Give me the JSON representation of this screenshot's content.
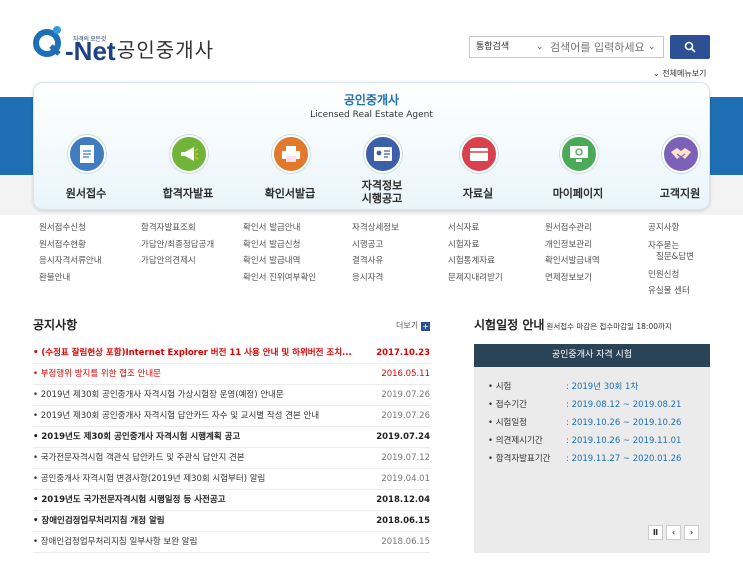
{
  "header": {
    "logo_slogan": "자격의 모든것",
    "logo_text": "Net",
    "site_title": "공인중개사",
    "search": {
      "type_value": "통합검색",
      "placeholder": "검색어를 입력하세요"
    },
    "all_menu_label": "전체메뉴보기"
  },
  "panel": {
    "title": "공인중개사",
    "subtitle": "Licensed Real Estate Agent"
  },
  "nav": [
    {
      "label": "원서접수",
      "icon": "document-icon",
      "color": "#3f7cc0"
    },
    {
      "label": "합격자발표",
      "icon": "megaphone-icon",
      "color": "#72b43a"
    },
    {
      "label": "확인서발급",
      "icon": "printer-icon",
      "color": "#e0792c"
    },
    {
      "label": "자격정보\n시행공고",
      "icon": "id-card-icon",
      "color": "#3d5fa8"
    },
    {
      "label": "자료실",
      "icon": "folder-icon",
      "color": "#d9414e"
    },
    {
      "label": "마이페이지",
      "icon": "monitor-icon",
      "color": "#4aaa5a"
    },
    {
      "label": "고객지원",
      "icon": "handshake-icon",
      "color": "#7b62b8"
    }
  ],
  "sublinks": [
    [
      "원서접수신청",
      "원서접수현황",
      "응시자격서류안내",
      "환불안내"
    ],
    [
      "합격자발표조회",
      "가답안/최종정답공개",
      "가답안의견제시"
    ],
    [
      "확인서 발급안내",
      "확인서 발급신청",
      "확인서 발급내역",
      "확인서 진위여부확인"
    ],
    [
      "자격상세정보",
      "시행공고",
      "결격사유",
      "응시자격"
    ],
    [
      "서식자료",
      "시험자료",
      "시험통계자료",
      "문제지내려받기"
    ],
    [
      "원서접수관리",
      "개인정보관리",
      "확인서발급내역",
      "면제정보보기"
    ],
    [
      "공지사항",
      "자주묻는\n질문&답변",
      "민원신청",
      "유실물 센터"
    ]
  ],
  "notices": {
    "title": "공지사항",
    "more_label": "더보기",
    "items": [
      {
        "text": "(수정표 잘림현상 포함)Internet Explorer 버전 11 사용 안내 및 하위버전 조치...",
        "date": "2017.10.23",
        "style": "red bold"
      },
      {
        "text": "부정행위 방지를 위한 협조 안내문",
        "date": "2016.05.11",
        "style": "red"
      },
      {
        "text": "2019년 제30회 공인중개사 자격시험 가상시험장 운영(예정) 안내문",
        "date": "2019.07.26",
        "style": ""
      },
      {
        "text": "2019년 제30회 공인중개사 자격시험 답안카드 자수 및 교시별 작성 견본 안내",
        "date": "2019.07.26",
        "style": ""
      },
      {
        "text": "2019년도 제30회 공인중개사 자격시험 시행계획 공고",
        "date": "2019.07.24",
        "style": "bold"
      },
      {
        "text": "국가전문자격시험 객관식 답안카드 및 주관식 답안지 견본",
        "date": "2019.07.12",
        "style": ""
      },
      {
        "text": "공인중개사 자격시험 변경사항(2019년 제30회 시험부터) 알림",
        "date": "2019.04.01",
        "style": ""
      },
      {
        "text": "2019년도 국가전문자격시험 시행일정 등 사전공고",
        "date": "2018.12.04",
        "style": "bold"
      },
      {
        "text": "장애인검정업무처리지침 개정 알림",
        "date": "2018.06.15",
        "style": "bold"
      },
      {
        "text": "장애인검정업무처리지침 일부사항 보완 알림",
        "date": "2018.06.15",
        "style": ""
      }
    ]
  },
  "schedule": {
    "title": "시험일정 안내",
    "note": "원서접수 마감은 접수마감일 18:00까지",
    "box_title": "공인중개사 자격 시험",
    "rows": [
      {
        "k": "시험",
        "v": ": 2019년 30회 1차"
      },
      {
        "k": "접수기간",
        "v": ": 2019.08.12 ~ 2019.08.21"
      },
      {
        "k": "시험일정",
        "v": ": 2019.10.26 ~ 2019.10.26"
      },
      {
        "k": "의견제시기간",
        "v": ": 2019.10.26 ~ 2019.11.01"
      },
      {
        "k": "합격자발표기간",
        "v": ": 2019.11.27 ~ 2020.01.26"
      }
    ],
    "controls": [
      "pause",
      "prev",
      "next"
    ]
  }
}
